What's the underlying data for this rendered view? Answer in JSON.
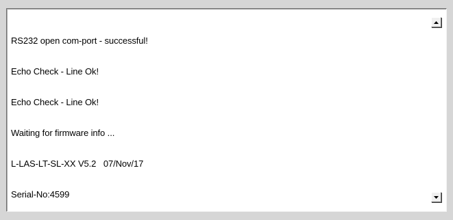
{
  "log": {
    "lines": [
      "RS232 open com-port - successful!",
      "Echo Check - Line Ok!",
      "Echo Check - Line Ok!",
      "Waiting for firmware info ...",
      "L-LAS-LT-SL-XX V5.2   07/Nov/17",
      "Serial-No:4599"
    ]
  },
  "scrollbar": {
    "up_icon": "arrow-up-icon",
    "down_icon": "arrow-down-icon"
  }
}
